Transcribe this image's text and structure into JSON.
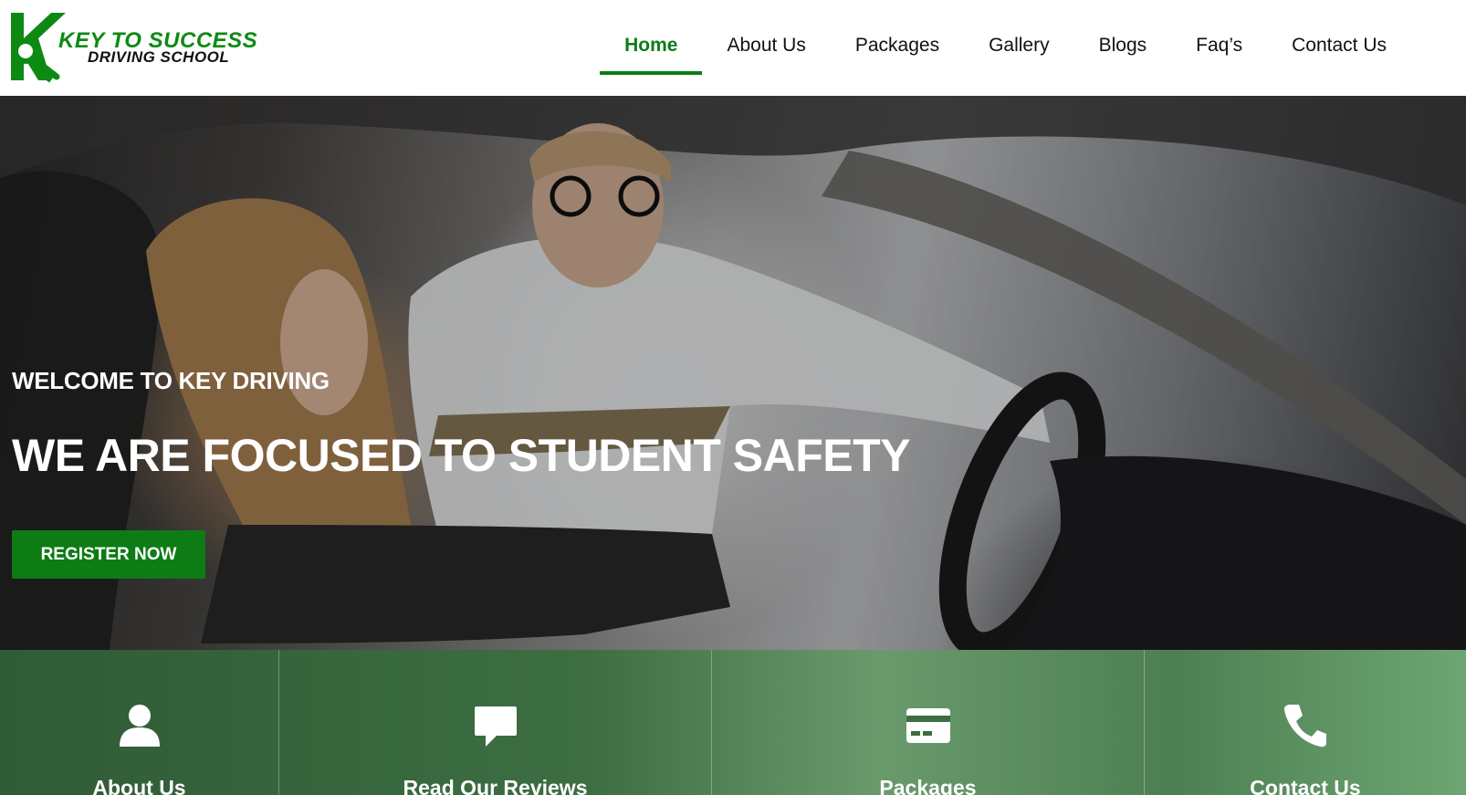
{
  "brand": {
    "line1": "KEY TO SUCCESS",
    "line2": "DRIVING SCHOOL",
    "color": "#0d8a14"
  },
  "nav": {
    "items": [
      {
        "label": "Home",
        "active": true
      },
      {
        "label": "About Us"
      },
      {
        "label": "Packages"
      },
      {
        "label": "Gallery"
      },
      {
        "label": "Blogs"
      },
      {
        "label": "Faq’s"
      },
      {
        "label": "Contact Us"
      }
    ]
  },
  "hero": {
    "subtitle": "WELCOME TO KEY DRIVING",
    "title": "WE ARE FOCUSED TO STUDENT SAFETY",
    "cta": "REGISTER NOW"
  },
  "features": [
    {
      "label": "About Us",
      "icon": "user-icon"
    },
    {
      "label": "Read Our Reviews",
      "icon": "comment-icon"
    },
    {
      "label": "Packages",
      "icon": "credit-card-icon"
    },
    {
      "label": "Contact Us",
      "icon": "phone-icon"
    }
  ],
  "colors": {
    "accent": "#0d7c15",
    "feature_overlay": "#2f5b35"
  }
}
